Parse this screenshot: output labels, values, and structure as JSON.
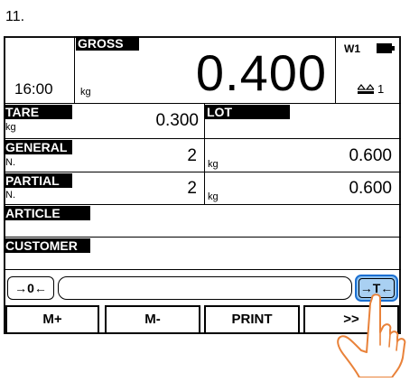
{
  "step_number": "11.",
  "header": {
    "gross_label": "GROSS",
    "time": "16:00",
    "weight_unit": "kg",
    "weight_value": "0.400",
    "scale_id": "W1",
    "platform_number": "1"
  },
  "fields": {
    "tare": {
      "label": "TARE",
      "unit": "kg",
      "value": "0.300"
    },
    "lot": {
      "label": "LOT",
      "value": ""
    },
    "general": {
      "label": "GENERAL",
      "count_label": "N.",
      "count": "2",
      "unit": "kg",
      "total": "0.600"
    },
    "partial": {
      "label": "PARTIAL",
      "count_label": "N.",
      "count": "2",
      "unit": "kg",
      "total": "0.600"
    },
    "article": {
      "label": "ARTICLE",
      "value": ""
    },
    "customer": {
      "label": "CUSTOMER",
      "value": ""
    }
  },
  "toolbar": {
    "zero_label": "→0←",
    "input_value": "",
    "tare_label": "→T←"
  },
  "function_keys": [
    "M+",
    "M-",
    "PRINT",
    ">>"
  ],
  "icons": {
    "battery": "battery-icon",
    "scale": "scale-icon",
    "hand": "pointing-hand-icon"
  }
}
